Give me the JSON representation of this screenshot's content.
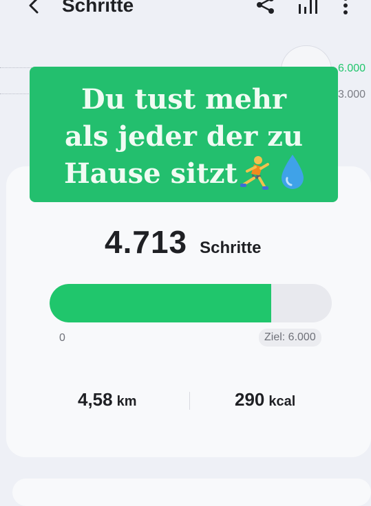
{
  "header": {
    "title": "Schritte"
  },
  "chart": {
    "gridlines": [
      "6.000",
      "3.000"
    ],
    "accent_label_color": "#20c66c"
  },
  "overlay": {
    "line1": "Du tust mehr",
    "line2": "als jeder der zu",
    "line3": "Hause sitzt",
    "emojis": [
      "runner-icon",
      "droplet-icon"
    ]
  },
  "summary": {
    "steps_value": "4.713",
    "steps_unit": "Schritte",
    "progress_fraction": 0.7855,
    "progress_min_label": "0",
    "goal_label": "Ziel: 6.000",
    "distance_value": "4,58",
    "distance_unit": "km",
    "energy_value": "290",
    "energy_unit": "kcal"
  },
  "colors": {
    "accent": "#20c66c",
    "banner": "#23bf6e"
  }
}
